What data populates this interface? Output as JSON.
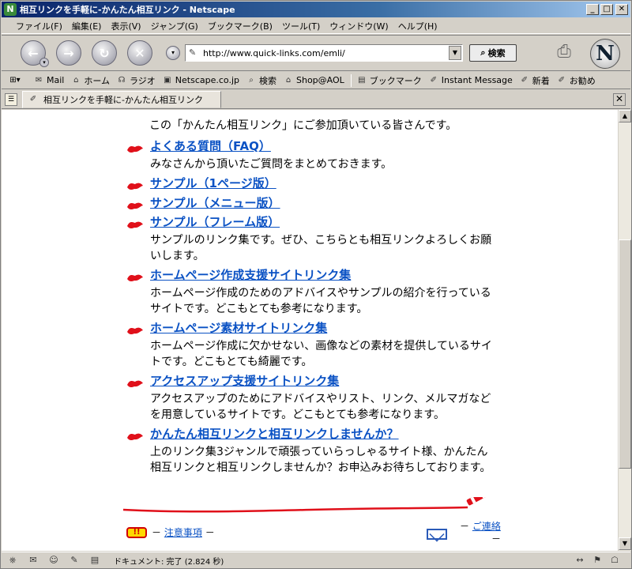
{
  "window": {
    "title": "相互リンクを手軽に-かんたん相互リンク - Netscape",
    "min_label": "_",
    "max_label": "□",
    "close_label": "✕"
  },
  "menu": [
    "ファイル(F)",
    "編集(E)",
    "表示(V)",
    "ジャンプ(G)",
    "ブックマーク(B)",
    "ツール(T)",
    "ウィンドウ(W)",
    "ヘルプ(H)"
  ],
  "nav": {
    "back_icon": "back-arrow-icon",
    "forward_icon": "forward-arrow-icon",
    "reload_icon": "reload-icon",
    "stop_icon": "stop-icon",
    "url": "http://www.quick-links.com/emli/",
    "search_label": "検索",
    "throbber_letter": "N"
  },
  "personal_toolbar": [
    {
      "icon": "mail-icon",
      "label": "Mail"
    },
    {
      "icon": "home-icon",
      "label": "ホーム"
    },
    {
      "icon": "radio-icon",
      "label": "ラジオ"
    },
    {
      "icon": "my-netscape-icon",
      "label": "Netscape.co.jp"
    },
    {
      "icon": "search-icon",
      "label": "検索"
    },
    {
      "icon": "shop-icon",
      "label": "Shop@AOL"
    },
    {
      "icon": "bookmark-icon",
      "label": "ブックマーク"
    },
    {
      "icon": "bookmark-icon",
      "label": "Instant Message"
    },
    {
      "icon": "bookmark-icon",
      "label": "新着"
    },
    {
      "icon": "bookmark-icon",
      "label": "お勧め"
    }
  ],
  "tab": {
    "label": "相互リンクを手軽に-かんたん相互リンク"
  },
  "content": {
    "intro_text": "この「かんたん相互リンク」にご参加頂いている皆さんです。",
    "sections": [
      {
        "link": "よくある質問（FAQ）",
        "desc": "みなさんから頂いたご質問をまとめておきます。"
      },
      {
        "link": "サンプル（1ページ版）",
        "desc": ""
      },
      {
        "link": "サンプル（メニュー版）",
        "desc": ""
      },
      {
        "link": "サンプル（フレーム版）",
        "desc": "サンプルのリンク集です。ぜひ、こちらとも相互リンクよろしくお願いします。"
      },
      {
        "link": "ホームページ作成支援サイトリンク集",
        "desc": "ホームページ作成のためのアドバイスやサンプルの紹介を行っているサイトです。どこもとても参考になります。"
      },
      {
        "link": "ホームページ素材サイトリンク集",
        "desc": "ホームページ作成に欠かせない、画像などの素材を提供しているサイトです。どこもとても綺麗です。"
      },
      {
        "link": "アクセスアップ支援サイトリンク集",
        "desc": "アクセスアップのためにアドバイスやリスト、リンク、メルマガなどを用意しているサイトです。どこもとても参考になります。"
      },
      {
        "link": "かんたん相互リンクと相互リンクしませんか？",
        "desc": "上のリンク集3ジャンルで頑張っていらっしゃるサイト様、かんたん相互リンクと相互リンクしませんか？お申込みお待ちしております。"
      }
    ],
    "notice_prefix": "－",
    "notice_link": "注意事項",
    "notice_suffix": "－",
    "notice_icon_text": "!!",
    "contact_prefix": "－",
    "contact_link": "ご連絡",
    "contact_suffix": "－"
  },
  "status": {
    "text": "ドキュメント: 完了 (2.824 秒)"
  },
  "colors": {
    "link": "#0b52c4",
    "bullet_red": "#e0101a",
    "title_bar": "#0a246a"
  }
}
